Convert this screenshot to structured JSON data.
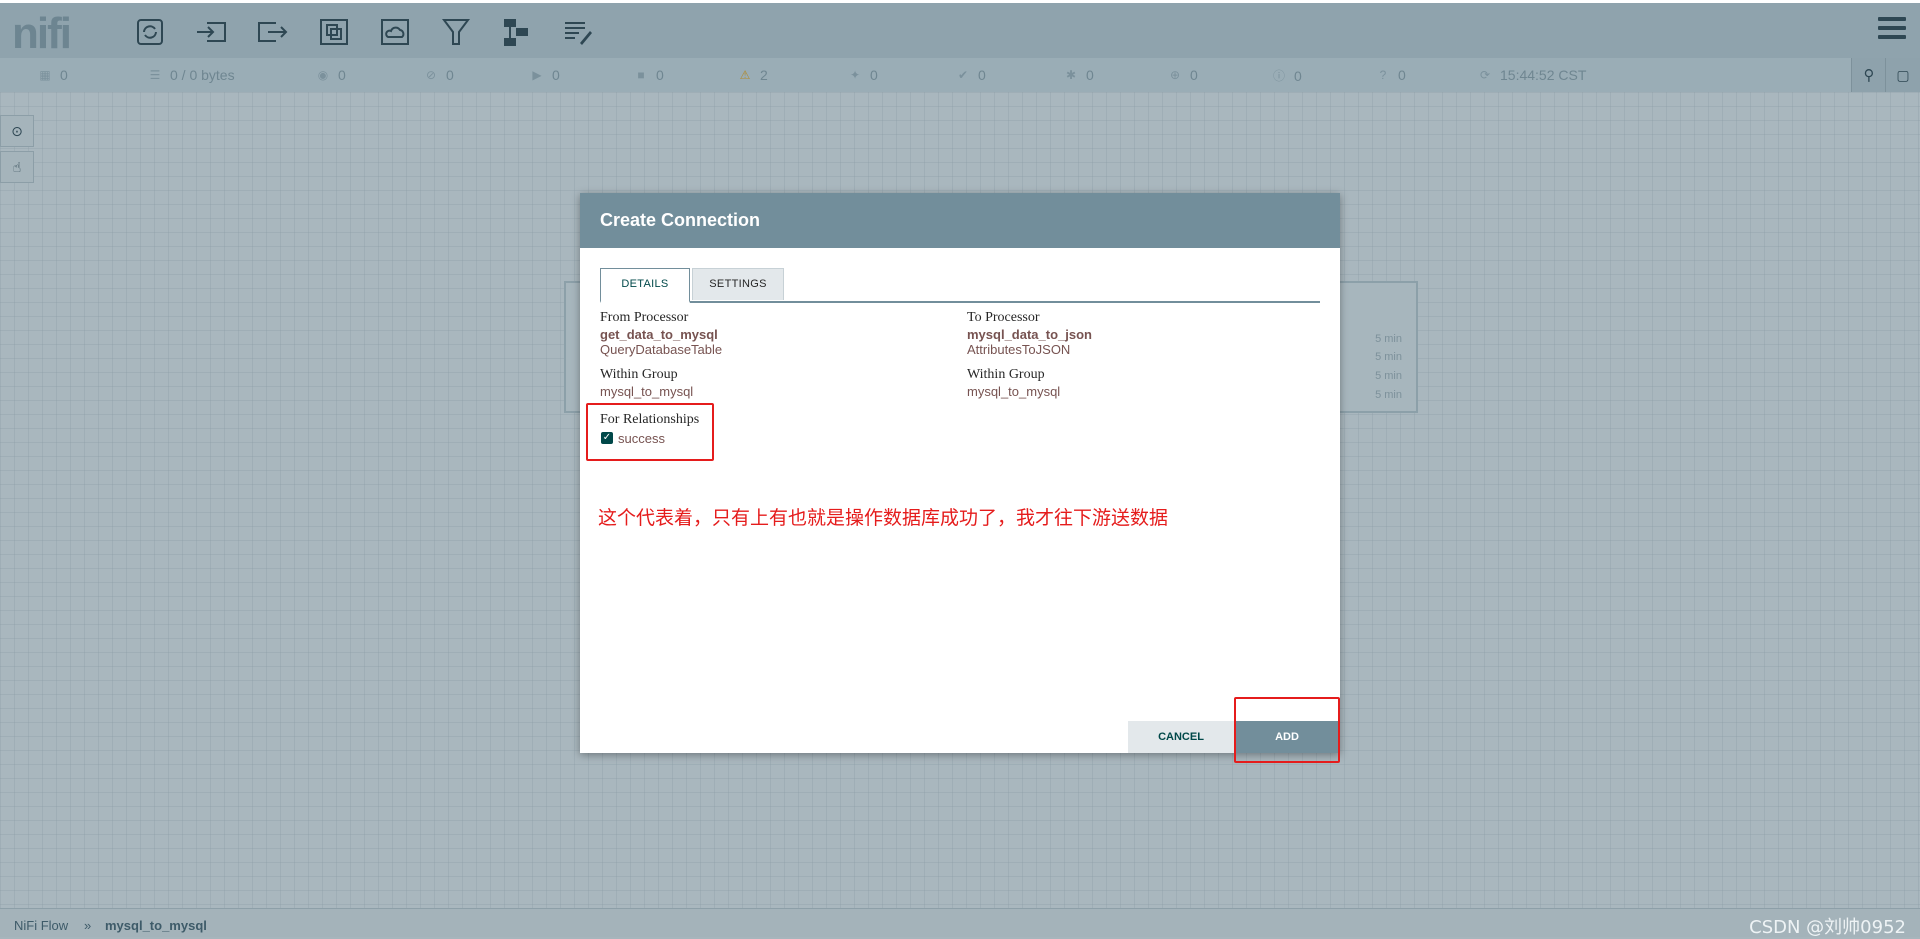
{
  "header": {
    "logo": "nifi",
    "tools": [
      "processor-icon",
      "input-port-icon",
      "output-port-icon",
      "process-group-icon",
      "remote-process-group-icon",
      "funnel-icon",
      "template-icon",
      "label-icon"
    ]
  },
  "status": {
    "threads": "0",
    "queued": "0 / 0 bytes",
    "transmitting": "0",
    "not_transmitting": "0",
    "running": "0",
    "stopped": "0",
    "invalid": "2",
    "disabled": "0",
    "up_to_date": "0",
    "locally_modified": "0",
    "stale": "0",
    "locally_modified_stale": "0",
    "sync_failure": "0",
    "last_refresh": "15:44:52 CST"
  },
  "ghost_processor": {
    "rows": [
      "5 min",
      "5 min",
      "5 min",
      "5 min"
    ]
  },
  "dialog": {
    "title": "Create Connection",
    "tabs": [
      "DETAILS",
      "SETTINGS"
    ],
    "from_label": "From Processor",
    "from_name": "get_data_to_mysql",
    "from_type": "QueryDatabaseTable",
    "to_label": "To Processor",
    "to_name": "mysql_data_to_json",
    "to_type": "AttributesToJSON",
    "within_group_label_left": "Within Group",
    "within_group_left": "mysql_to_mysql",
    "within_group_label_right": "Within Group",
    "within_group_right": "mysql_to_mysql",
    "relationships_label": "For Relationships",
    "relationship": "success",
    "relationship_checked": true,
    "annotation": "这个代表着，只有上有也就是操作数据库成功了，我才往下游送数据",
    "cancel_label": "CANCEL",
    "add_label": "ADD"
  },
  "breadcrumb": {
    "root": "NiFi Flow",
    "separator": "»",
    "current": "mysql_to_mysql"
  },
  "watermark": "CSDN @刘帅0952",
  "colors": {
    "primary": "#728e9b",
    "accent": "#004849",
    "annotation_red": "#e51c1c",
    "value_text": "#775351"
  }
}
